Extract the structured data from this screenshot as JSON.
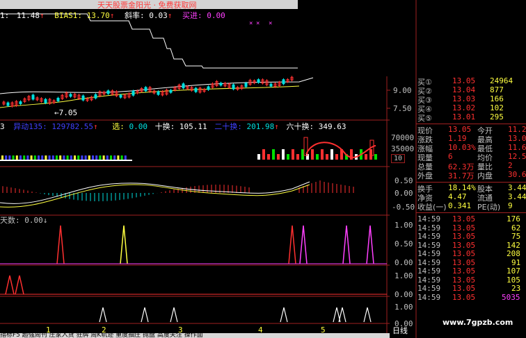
{
  "top_banner": {
    "text": "天天股票金阳光 · 免费获取网"
  },
  "main_indicator": {
    "prefix": "1:",
    "v1": "11.48",
    "bias_label": "BIAS1:",
    "bias_value": "13.70",
    "slope_label": "斜率:",
    "slope_value": "0.03",
    "buy_label": "买进:",
    "buy_value": "0.00"
  },
  "price_axis": [
    "9.00",
    "7.50"
  ],
  "low_marker": "7.05",
  "volume_indicator": {
    "prefix": "3",
    "move_label": "异动135:",
    "move_value": "129782.55",
    "select_label": "选:",
    "select_value": "0.00",
    "ten_label": "十换:",
    "ten_value": "105.11",
    "twenty_label": "二十换:",
    "twenty_value": "201.98",
    "sixty_label": "六十换:",
    "sixty_value": "349.63"
  },
  "volume_axis": [
    "70000",
    "35000"
  ],
  "volume_unit": "10",
  "macd_axis": [
    "0.50",
    "0.00",
    "-0.50"
  ],
  "signal_panel": {
    "label": "天数:",
    "value": "0.00"
  },
  "signal_axis": [
    "1.00",
    "0.50",
    "0.00"
  ],
  "panel5_axis": [
    "1.00",
    "0.00"
  ],
  "panel6_axis": [
    "1.00",
    "0.00"
  ],
  "x_axis_ticks": [
    "1",
    "2",
    "3",
    "4",
    "5"
  ],
  "period_label": "日线",
  "bottom_tabs": [
    "指标F5",
    "超强周刊",
    "庄家入货",
    "狂牌",
    "周K轨迹",
    "重度抽庄",
    "抛盘",
    "高度关注",
    "操作面"
  ],
  "order_book": [
    {
      "label": "买①",
      "price": "13.05",
      "volume": "24964"
    },
    {
      "label": "买②",
      "price": "13.04",
      "volume": "877"
    },
    {
      "label": "买③",
      "price": "13.03",
      "volume": "166"
    },
    {
      "label": "买④",
      "price": "13.02",
      "volume": "102"
    },
    {
      "label": "买⑤",
      "price": "13.01",
      "volume": "295"
    }
  ],
  "quote_rows": [
    {
      "l1": "现价",
      "v1": "13.05",
      "l2": "今开",
      "v2": "11.2"
    },
    {
      "l1": "涨跌",
      "v1": "1.19",
      "l2": "最高",
      "v2": "13.0"
    },
    {
      "l1": "涨幅",
      "v1": "10.03%",
      "l2": "最低",
      "v2": "11.6"
    },
    {
      "l1": "现量",
      "v1": "6",
      "l2": "均价",
      "v2": "12.5"
    },
    {
      "l1": "总量",
      "v1": "62.3万",
      "l2": "量比",
      "v2": "2"
    },
    {
      "l1": "外盘",
      "v1": "31.7万",
      "l2": "内盘",
      "v2": "30.6"
    }
  ],
  "fundamentals": [
    {
      "l1": "换手",
      "v1": "18.14%",
      "l2": "股本",
      "v2": "3.44"
    },
    {
      "l1": "净资",
      "v1": "4.47",
      "l2": "流通",
      "v2": "3.44"
    },
    {
      "l1": "收益(一)",
      "v1": "0.341",
      "l2": "PE(动)",
      "v2": "9"
    }
  ],
  "trades": [
    {
      "time": "14:59",
      "price": "13.05",
      "vol": "176"
    },
    {
      "time": "14:59",
      "price": "13.05",
      "vol": "62"
    },
    {
      "time": "14:59",
      "price": "13.05",
      "vol": "75"
    },
    {
      "time": "14:59",
      "price": "13.05",
      "vol": "142"
    },
    {
      "time": "14:59",
      "price": "13.05",
      "vol": "208"
    },
    {
      "time": "14:59",
      "price": "13.05",
      "vol": "91"
    },
    {
      "time": "14:59",
      "price": "13.05",
      "vol": "107"
    },
    {
      "time": "14:59",
      "price": "13.05",
      "vol": "105"
    },
    {
      "time": "14:59",
      "price": "13.05",
      "vol": "23"
    },
    {
      "time": "14:59",
      "price": "13.05",
      "vol": "5035"
    }
  ],
  "watermark": "www.7gpzb.com",
  "colors": {
    "up": "#ff3030",
    "down": "#00e0e0",
    "yellow": "#ffff40",
    "magenta": "#ff40ff",
    "grid": "#a02020",
    "text": "#c0c0c0"
  }
}
